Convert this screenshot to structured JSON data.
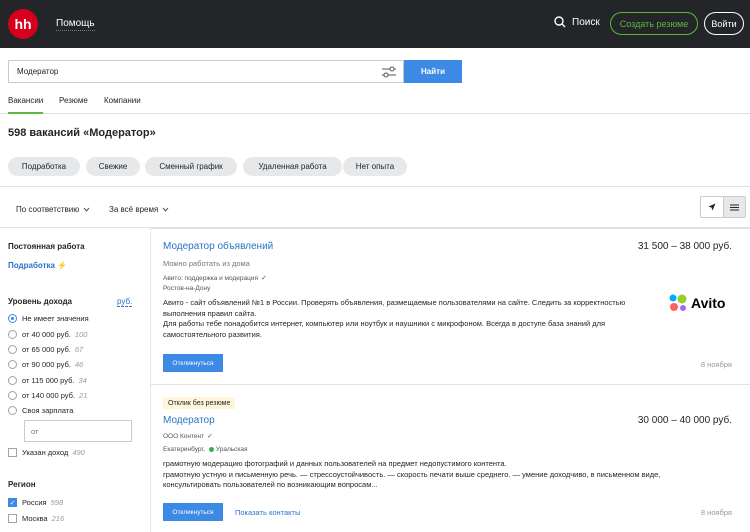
{
  "header": {
    "logo": "hh",
    "help": "Помощь",
    "search": "Поиск",
    "create_resume": "Создать резюме",
    "login": "Войти"
  },
  "search": {
    "value": "Модератор",
    "button": "Найти"
  },
  "tabs": [
    "Вакансии",
    "Резюме",
    "Компании"
  ],
  "results_title": "598 вакансий «Модератор»",
  "chips": [
    "Подработка",
    "Свежие",
    "Сменный график",
    "Удаленная работа",
    "Нет опыта"
  ],
  "sort": {
    "order": "По соответствию",
    "period": "За всё время"
  },
  "sidebar": {
    "permanent": {
      "heading": "Постоянная работа",
      "link": "Подработка",
      "link_icon": "⚡"
    },
    "income": {
      "heading": "Уровень дохода",
      "currency": "руб.",
      "options": [
        {
          "label": "Не имеет значения",
          "count": "",
          "selected": true
        },
        {
          "label": "от 40 000 руб.",
          "count": "100"
        },
        {
          "label": "от 65 000 руб.",
          "count": "67"
        },
        {
          "label": "от 90 000 руб.",
          "count": "46"
        },
        {
          "label": "от 115 000 руб.",
          "count": "34"
        },
        {
          "label": "от 140 000 руб.",
          "count": "21"
        },
        {
          "label": "Своя зарплата",
          "count": ""
        }
      ],
      "own_placeholder": "от",
      "specified": {
        "label": "Указан доход",
        "count": "490"
      }
    },
    "region": {
      "heading": "Регион",
      "options": [
        {
          "label": "Россия",
          "count": "598",
          "checked": true
        },
        {
          "label": "Москва",
          "count": "216",
          "checked": false
        }
      ]
    }
  },
  "vacancies": [
    {
      "title": "Модератор объявлений",
      "salary": "31 500 – 38 000 руб.",
      "remote": "Можно работать из дома",
      "company": "Авито: поддержка и модерация",
      "city": "Ростов-на-Дону",
      "description": [
        "Авито - сайт объявлений №1 в России. Проверять объявления, размещаемые пользователями на сайте. Следить за корректностью выполнения правил сайта.",
        "Для работы тебе понадобится интернет, компьютер или ноутбук и наушники с микрофоном. Всегда в доступе база знаний для самостоятельного развития."
      ],
      "respond": "Откликнуться",
      "date": "8 ноября",
      "logo_text": "Avito"
    },
    {
      "badge": "Отклик без резюме",
      "title": "Модератор",
      "salary": "30 000 – 40 000 руб.",
      "company": "ООО Контент",
      "city": "Екатеринбург,",
      "metro": "Уральская",
      "metro_color": "#2db14b",
      "description": [
        "грамотную модерацию фотографий и данных пользователей на предмет недопустимого контента.",
        "грамотную устную и письменную речь. — стрессоустойчивость. — скорость печати выше среднего. — умение доходчиво, в письменном виде, консультировать пользователей по возникающим вопросам..."
      ],
      "respond": "Откликнуться",
      "contacts": "Показать контакты",
      "date": "8 ноября"
    }
  ],
  "colors": {
    "header_bg": "#232529",
    "brand_red": "#d6001c",
    "accent_green": "#5ab83f",
    "accent_blue": "#3c89e6",
    "link_blue": "#2a73c7"
  }
}
